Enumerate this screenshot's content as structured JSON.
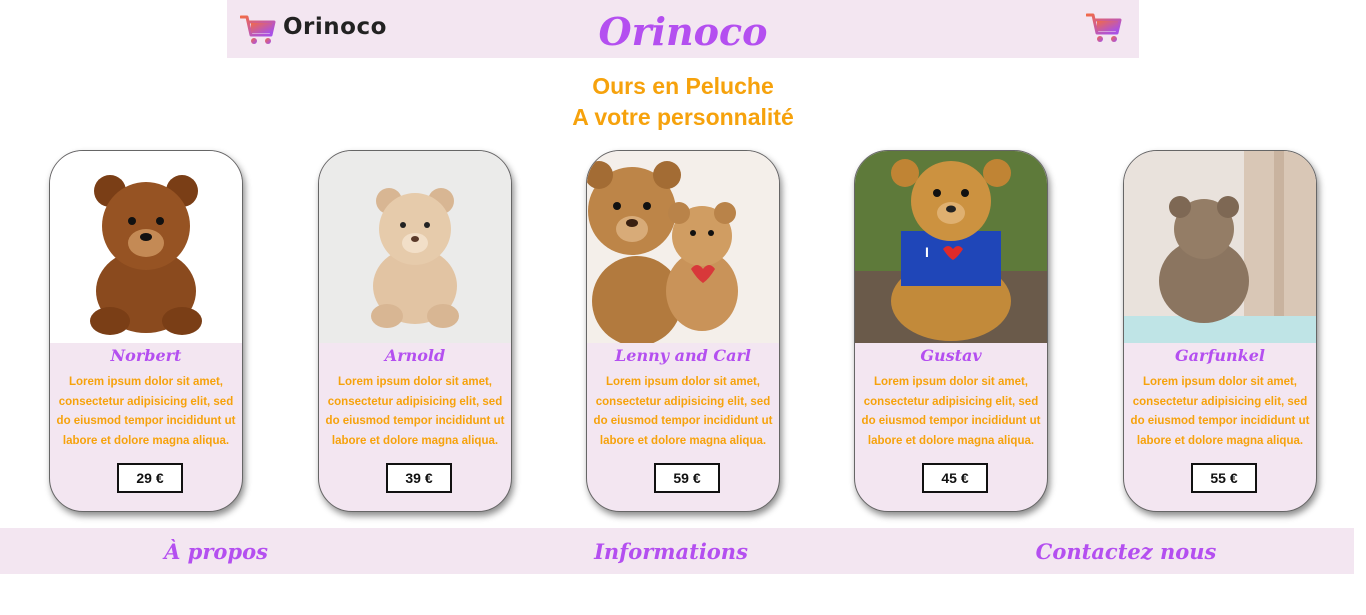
{
  "header": {
    "logo_text": "Orinoco",
    "title": "Orinoco",
    "logo_icon": "cart-icon",
    "cart_icon": "cart-icon"
  },
  "tagline": {
    "line1": "Ours en Peluche",
    "line2": "A votre personnalité"
  },
  "products": [
    {
      "name": "Norbert",
      "description": "Lorem ipsum dolor sit amet, consectetur adipisicing elit, sed do eiusmod tempor incididunt ut labore et dolore magna aliqua.",
      "price": "29 €"
    },
    {
      "name": "Arnold",
      "description": "Lorem ipsum dolor sit amet, consectetur adipisicing elit, sed do eiusmod tempor incididunt ut labore et dolore magna aliqua.",
      "price": "39 €"
    },
    {
      "name": "Lenny and Carl",
      "description": "Lorem ipsum dolor sit amet, consectetur adipisicing elit, sed do eiusmod tempor incididunt ut labore et dolore magna aliqua.",
      "price": "59 €"
    },
    {
      "name": "Gustav",
      "description": "Lorem ipsum dolor sit amet, consectetur adipisicing elit, sed do eiusmod tempor incididunt ut labore et dolore magna aliqua.",
      "price": "45 €"
    },
    {
      "name": "Garfunkel",
      "description": "Lorem ipsum dolor sit amet, consectetur adipisicing elit, sed do eiusmod tempor incididunt ut labore et dolore magna aliqua.",
      "price": "55 €"
    }
  ],
  "footer": {
    "about": "À propos",
    "info": "Informations",
    "contact": "Contactez nous"
  },
  "colors": {
    "brand_purple": "#b44ff0",
    "accent_orange": "#f6a20c",
    "panel_pink": "#f3e6f1"
  }
}
